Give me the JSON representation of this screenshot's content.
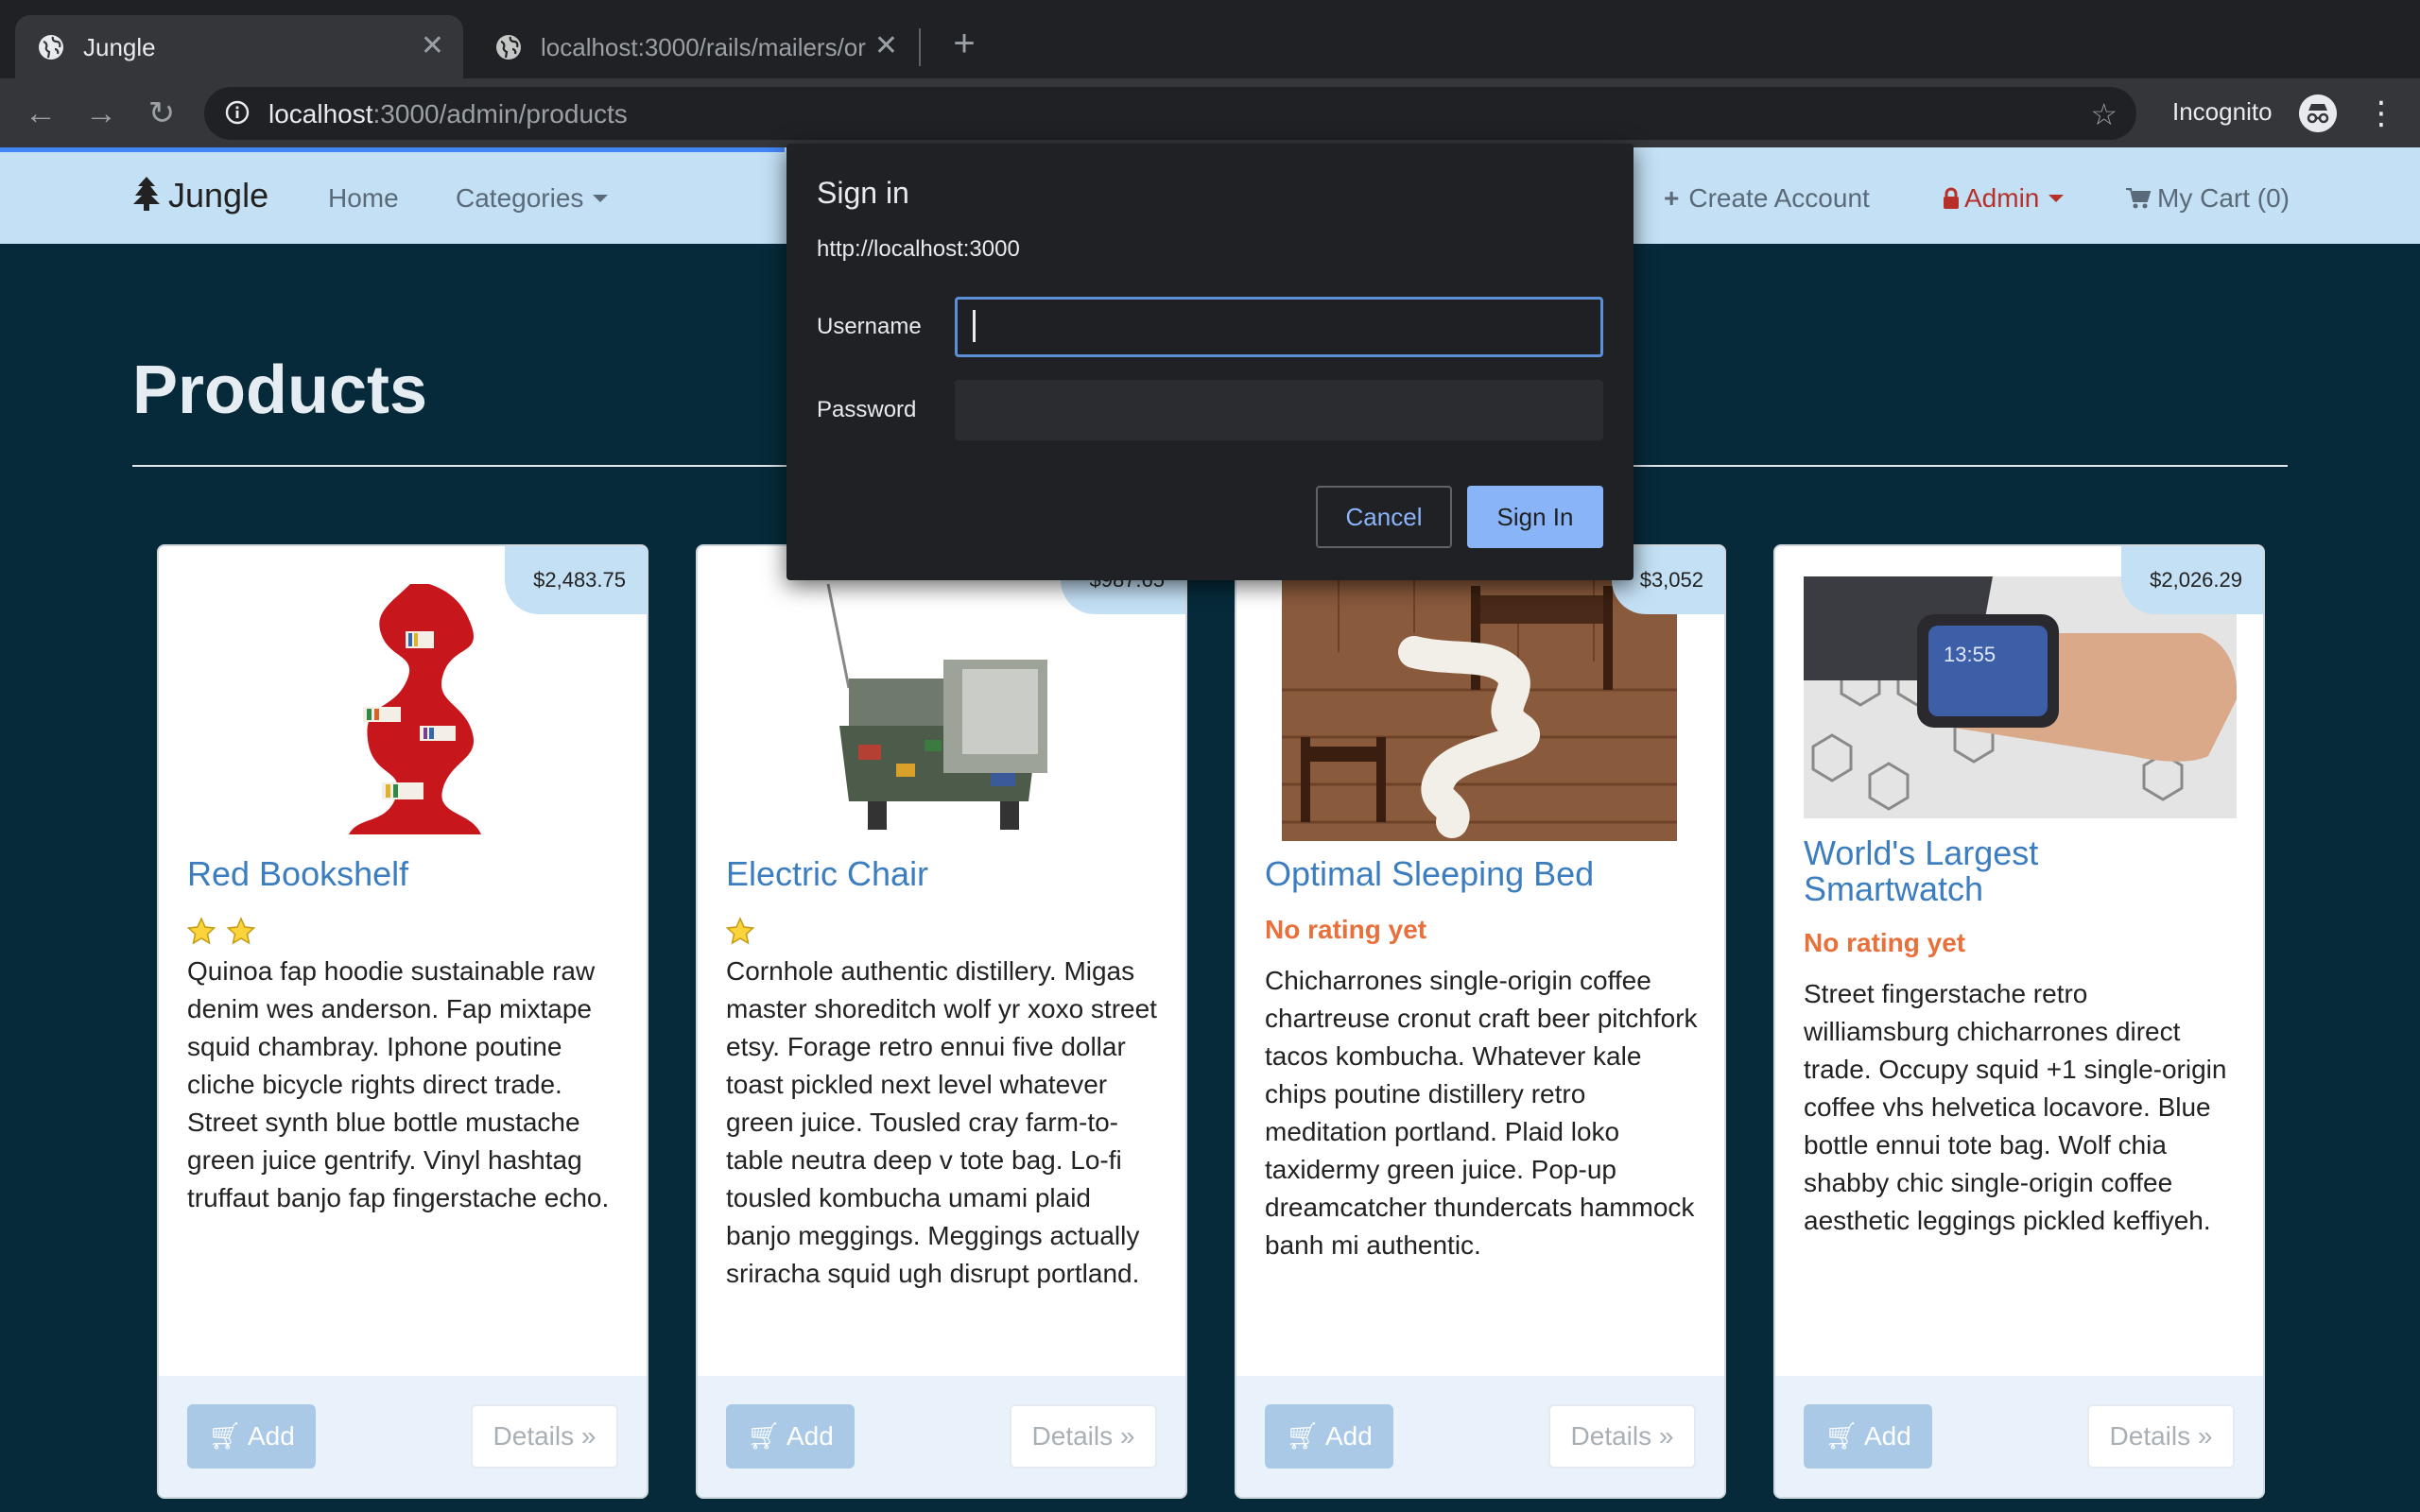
{
  "browser": {
    "tabs": [
      {
        "title": "Jungle",
        "active": true
      },
      {
        "title": "localhost:3000/rails/mailers/or",
        "active": false
      }
    ],
    "url_host": "localhost",
    "url_rest": ":3000/admin/products",
    "incognito_label": "Incognito"
  },
  "navbar": {
    "brand": "Jungle",
    "home": "Home",
    "categories": "Categories",
    "create_account": "Create Account",
    "admin": "Admin",
    "cart": "My Cart (0)"
  },
  "page": {
    "title": "Products"
  },
  "products": [
    {
      "name": "Red Bookshelf",
      "price": "$2,483.75",
      "stars": 2,
      "rating_text": "",
      "description": "Quinoa fap hoodie sustainable raw denim wes anderson. Fap mixtape squid chambray. Iphone poutine cliche bicycle rights direct trade. Street synth blue bottle mustache green juice gentrify. Vinyl hashtag truffaut banjo fap fingerstache echo."
    },
    {
      "name": "Electric Chair",
      "price": "$987.65",
      "stars": 1,
      "rating_text": "",
      "description": "Cornhole authentic distillery. Migas master shoreditch wolf yr xoxo street etsy. Forage retro ennui five dollar toast pickled next level whatever green juice. Tousled cray farm-to-table neutra deep v tote bag. Lo-fi tousled kombucha umami plaid banjo meggings. Meggings actually sriracha squid ugh disrupt portland."
    },
    {
      "name": "Optimal Sleeping Bed",
      "price": "$3,052",
      "stars": 0,
      "rating_text": "No rating yet",
      "description": "Chicharrones single-origin coffee chartreuse cronut craft beer pitchfork tacos kombucha. Whatever kale chips poutine distillery retro meditation portland. Plaid loko taxidermy green juice. Pop-up dreamcatcher thundercats hammock banh mi authentic."
    },
    {
      "name": "World's Largest Smartwatch",
      "price": "$2,026.29",
      "stars": 0,
      "rating_text": "No rating yet",
      "description": "Street fingerstache retro williamsburg chicharrones direct trade. Occupy squid +1 single-origin coffee vhs helvetica locavore. Blue bottle ennui tote bag. Wolf chia shabby chic single-origin coffee aesthetic leggings pickled keffiyeh."
    }
  ],
  "buttons": {
    "add": "Add",
    "details": "Details »"
  },
  "dialog": {
    "title": "Sign in",
    "origin": "http://localhost:3000",
    "username_label": "Username",
    "password_label": "Password",
    "username_value": "",
    "password_value": "",
    "cancel": "Cancel",
    "sign_in": "Sign In"
  }
}
